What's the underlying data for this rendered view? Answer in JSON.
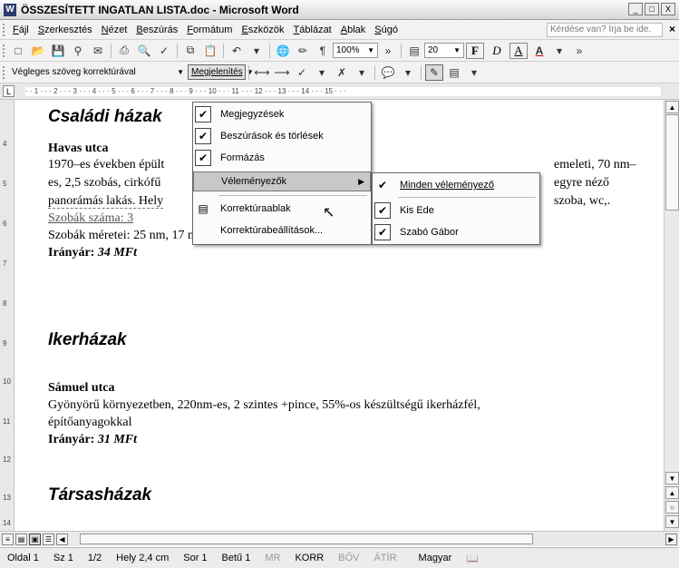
{
  "window": {
    "title": "ÖSSZESÍTETT INGATLAN LISTA.doc - Microsoft Word",
    "app_icon_label": "W",
    "buttons": [
      "_",
      "□",
      "X"
    ]
  },
  "menubar": {
    "items": [
      "Fájl",
      "Szerkesztés",
      "Nézet",
      "Beszúrás",
      "Formátum",
      "Eszközök",
      "Táblázat",
      "Ablak",
      "Súgó"
    ],
    "ask_placeholder": "Kérdése van? Írja be ide.",
    "close": "×"
  },
  "toolbar_standard": {
    "zoom": "100%",
    "font_size": "20",
    "bold": "F",
    "italic": "D",
    "underline": "A"
  },
  "toolbar_review": {
    "display_mode": "Végleges szöveg korrektúrával",
    "show_menu": "Megjelenítés"
  },
  "ruler": {
    "marks": "· · 1 · · · 2 · · · 3 · · · 4 · · · 5 · · · 6 · · · 7 · · · 8 · · · 9 · · · 10 · · · 11 · · · 12 · · · 13 · · · 14 · · · 15 · · ·",
    "vertical_marks": [
      "4",
      "5",
      "6",
      "7",
      "8",
      "9",
      "10",
      "11",
      "12",
      "13",
      "14"
    ]
  },
  "document": {
    "h1": "Családi házak",
    "s1_title": "Havas utca",
    "s1_line1a": "1970–es években épült",
    "s1_line1b": "emeleti, 70 nm–",
    "s1_line2a": "es, 2,5 szobás, cirkófű",
    "s1_line2b": "egyre néző",
    "s1_line3a": "panorámás lakás. Hely",
    "s1_line3b": "szoba, wc,.",
    "s1_line4": "Szobák száma: 3",
    "s1_line5": "Szobák méretei: 25 nm, 17 nm, 8 nm.",
    "s1_price_label": "Irányár:",
    "s1_price": "34 MFt",
    "h2": "Ikerházak",
    "s2_title": "Sámuel utca",
    "s2_line1": "Gyönyörű környezetben, 220nm-es, 2 szintes +pince, 55%-os készültségű ikerházfél,",
    "s2_line2": "építőanyagokkal",
    "s2_price_label": "Irányár:",
    "s2_price": "31 MFt",
    "h3": "Társasházak"
  },
  "menu_show": {
    "items": [
      {
        "label": "Megjegyzések",
        "checked": true
      },
      {
        "label": "Beszúrások és törlések",
        "checked": true
      },
      {
        "label": "Formázás",
        "checked": true
      },
      {
        "label": "Véleményezők",
        "checked": false,
        "submenu": true
      },
      {
        "label": "Korrektúraablak",
        "checked": false
      },
      {
        "label": "Korrektúrabeállítások...",
        "checked": false
      }
    ]
  },
  "menu_reviewers": {
    "items": [
      {
        "label": "Minden véleményező",
        "checked": true
      },
      {
        "label": "Kis Ede",
        "checked": true
      },
      {
        "label": "Szabó Gábor",
        "checked": true
      }
    ]
  },
  "statusbar": {
    "page": "Oldal 1",
    "section": "Sz 1",
    "pages": "1/2",
    "position": "Hely 2,4 cm",
    "row": "Sor 1",
    "col": "Betű 1",
    "rec": "MR",
    "trk": "KORR",
    "ext": "BŐV",
    "ovr": "ÁTÍR",
    "language": "Magyar"
  }
}
